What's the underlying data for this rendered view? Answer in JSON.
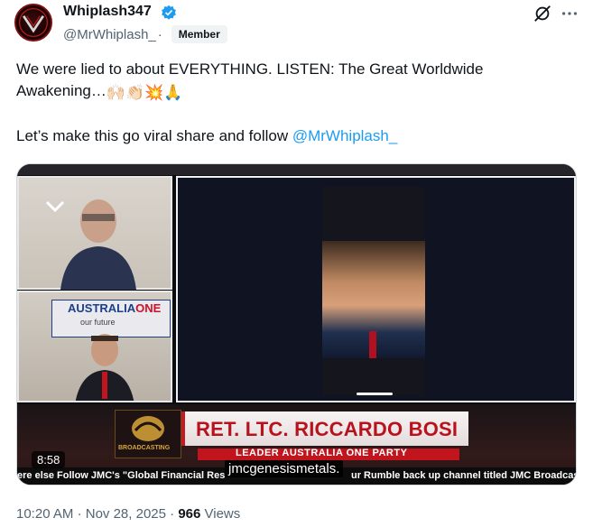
{
  "author": {
    "display_name": "Whiplash347",
    "handle": "@MrWhiplash_",
    "separator": "·",
    "badge": "Member"
  },
  "icons": {
    "verified": "verified-badge-icon",
    "grok": "grok-icon",
    "more": "more-options-icon",
    "chevron": "chevron-down-icon"
  },
  "tweet": {
    "line1": "We were lied to about EVERYTHING. LISTEN: The Great Worldwide Awakening…",
    "emojis": [
      "🙌🏻",
      "👏🏻",
      "💥",
      "🙏"
    ],
    "line2_prefix": "Let’s make this go viral share and follow ",
    "mention": "@MrWhiplash_"
  },
  "video": {
    "duration": "8:58",
    "name_plate": "RET. LTC. RICCARDO BOSI",
    "sub_plate": "LEADER AUSTRALIA ONE PARTY",
    "banner": {
      "left": "AUSTRALIA",
      "right": "ONE",
      "sub": "our future"
    },
    "logo_text": "BROADCASTING",
    "ticker_left": "ere else  Follow JMC's \"Global Financial Res",
    "ticker_right": "ur Rumble back up channel titled JMC Broadcas",
    "caption": "jmcgenesismetals."
  },
  "meta": {
    "time": "10:20 AM",
    "date": "Nov 28, 2025",
    "dot": "·",
    "views_count": "966",
    "views_label": "Views"
  },
  "colors": {
    "accent": "#1d9bf0",
    "text_secondary": "#536471",
    "badge_bg": "#eff3f4"
  }
}
